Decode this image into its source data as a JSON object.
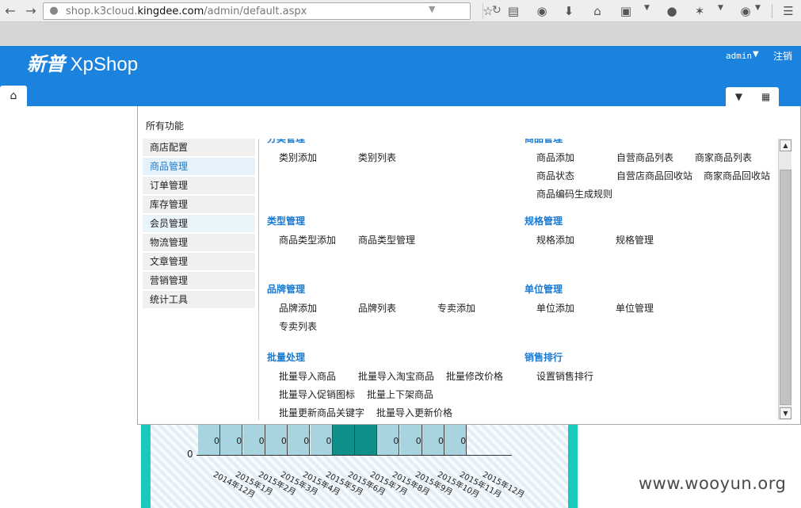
{
  "browser": {
    "url_prefix": "shop.k3cloud.",
    "url_domain": "kingdee.com",
    "url_path": "/admin/default.aspx"
  },
  "header": {
    "brand_cn": "新普",
    "brand_en": " XpShop",
    "user": "admin",
    "logout": "注销"
  },
  "panel": {
    "title": "所有功能",
    "menu": [
      "商店配置",
      "商品管理",
      "订单管理",
      "库存管理",
      "会员管理",
      "物流管理",
      "文章管理",
      "营销管理",
      "统计工具"
    ],
    "active_menu": "商品管理",
    "groups": {
      "category_title": "分类管理",
      "category_links": [
        "类别添加",
        "类别列表"
      ],
      "goods_title": "商品管理",
      "goods_links": [
        "商品添加",
        "自营商品列表",
        "商家商品列表",
        "商品状态",
        "自营店商品回收站",
        "商家商品回收站",
        "商品编码生成规则"
      ],
      "type_title": "类型管理",
      "type_links": [
        "商品类型添加",
        "商品类型管理"
      ],
      "spec_title": "规格管理",
      "spec_links": [
        "规格添加",
        "规格管理"
      ],
      "brand_title": "品牌管理",
      "brand_links": [
        "品牌添加",
        "品牌列表",
        "专卖添加",
        "专卖列表"
      ],
      "unit_title": "单位管理",
      "unit_links": [
        "单位添加",
        "单位管理"
      ],
      "batch_title": "批量处理",
      "batch_links": [
        "批量导入商品",
        "批量导入淘宝商品",
        "批量修改价格",
        "批量导入促销图标",
        "批量上下架商品",
        "批量更新商品关键字",
        "批量导入更新价格"
      ],
      "rank_title": "销售排行",
      "rank_links": [
        "设置销售排行"
      ]
    }
  },
  "chart_data": {
    "type": "bar",
    "categories": [
      "2014年12月",
      "2015年1月",
      "2015年2月",
      "2015年3月",
      "2015年4月",
      "2015年5月",
      "2015年6月",
      "2015年7月",
      "2015年8月",
      "2015年9月",
      "2015年10月",
      "2015年11月",
      "2015年12月"
    ],
    "values": [
      0,
      0,
      0,
      0,
      0,
      0,
      0,
      0,
      0,
      0,
      0,
      0,
      0
    ],
    "value_labels": [
      "0",
      "0",
      "0",
      "0",
      "0",
      "0",
      "",
      "",
      "0",
      "0",
      "0",
      "0",
      ""
    ],
    "y_tick": "0",
    "highlighted": [
      "2015年6月",
      "2015年7月"
    ],
    "colors": {
      "bar": "#a8d4e0",
      "highlight": "#0e8f8a"
    }
  },
  "watermark": "www.wooyun.org"
}
